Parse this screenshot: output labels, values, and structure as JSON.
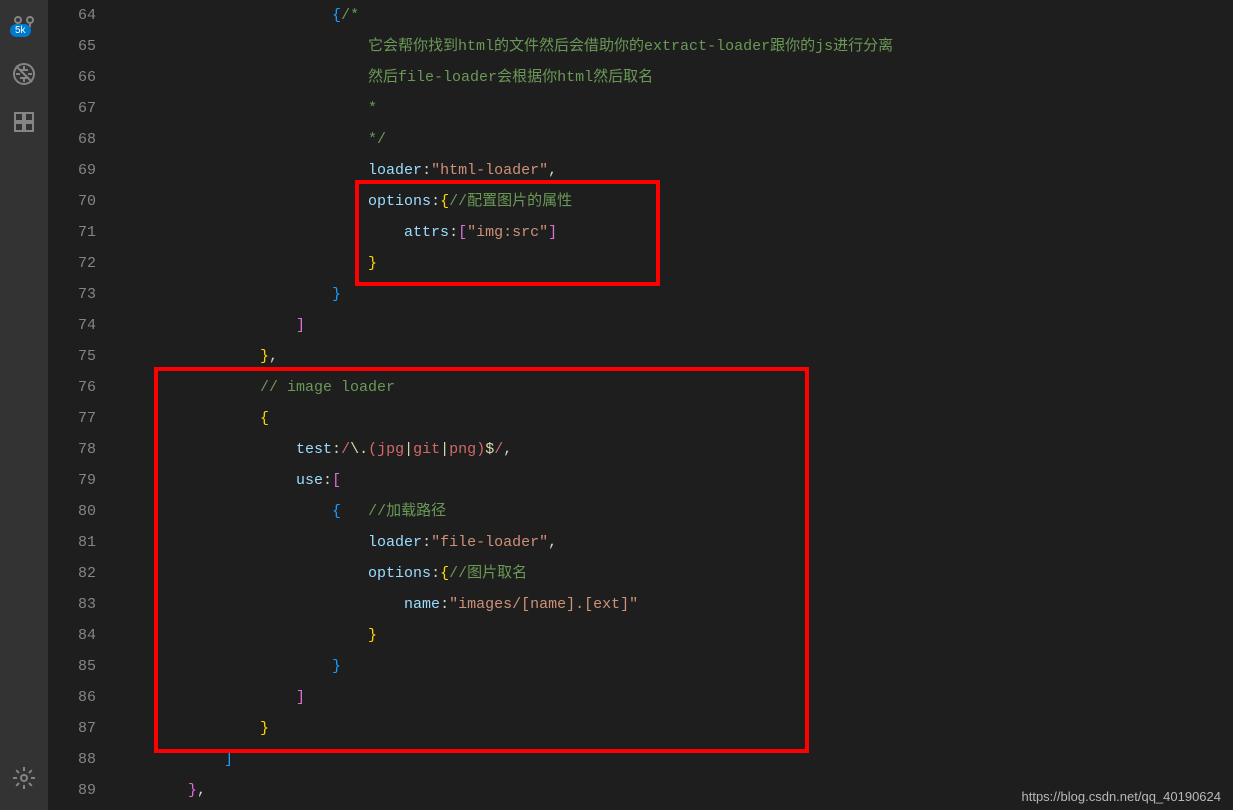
{
  "activityBar": {
    "badge": "5k"
  },
  "gutter": {
    "startLine": 64,
    "endLine": 89
  },
  "code": {
    "line64": {
      "brace": "{",
      "comment": "/*"
    },
    "line65": {
      "comment": "它会帮你找到html的文件然后会借助你的extract-loader跟你的js进行分离"
    },
    "line66": {
      "comment": "然后file-loader会根据你html然后取名"
    },
    "line67": {
      "comment": "*"
    },
    "line68": {
      "comment": "*/"
    },
    "line69": {
      "key": "loader",
      "colon": ":",
      "value": "\"html-loader\"",
      "comma": ","
    },
    "line70": {
      "key": "options",
      "colon": ":",
      "brace": "{",
      "comment": "//配置图片的属性"
    },
    "line71": {
      "key": "attrs",
      "colon": ":",
      "lbracket": "[",
      "value": "\"img:src\"",
      "rbracket": "]"
    },
    "line72": {
      "brace": "}"
    },
    "line73": {
      "brace": "}"
    },
    "line74": {
      "bracket": "]"
    },
    "line75": {
      "brace": "}",
      "comma": ","
    },
    "line76": {
      "comment": "// image loader"
    },
    "line77": {
      "brace": "{"
    },
    "line78": {
      "key": "test",
      "colon": ":",
      "regex_open": "/",
      "regex_esc": "\\.",
      "paren_l": "(",
      "a1": "jpg",
      "pipe1": "|",
      "a2": "git",
      "pipe2": "|",
      "a3": "png",
      "paren_r": ")",
      "dollar": "$",
      "regex_close": "/",
      "comma": ","
    },
    "line79": {
      "key": "use",
      "colon": ":",
      "bracket": "["
    },
    "line80": {
      "brace": "{",
      "comment": "//加载路径"
    },
    "line81": {
      "key": "loader",
      "colon": ":",
      "value": "\"file-loader\"",
      "comma": ","
    },
    "line82": {
      "key": "options",
      "colon": ":",
      "brace": "{",
      "comment": "//图片取名"
    },
    "line83": {
      "key": "name",
      "colon": ":",
      "value": "\"images/[name].[ext]\""
    },
    "line84": {
      "brace": "}"
    },
    "line85": {
      "brace": "}"
    },
    "line86": {
      "bracket": "]"
    },
    "line87": {
      "brace": "}"
    },
    "line88": {
      "bracket": "]"
    },
    "line89": {
      "brace": "}",
      "comma": ","
    }
  },
  "watermark": "https://blog.csdn.net/qq_40190624"
}
